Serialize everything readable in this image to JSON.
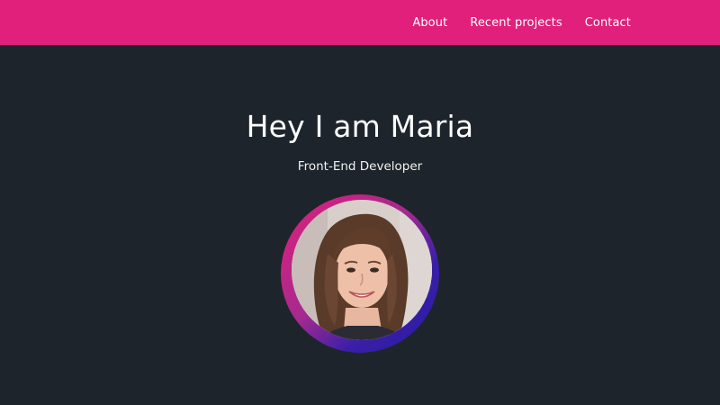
{
  "header": {
    "bg_color": "#e0207a",
    "nav": [
      {
        "label": "About"
      },
      {
        "label": "Recent projects"
      },
      {
        "label": "Contact"
      }
    ]
  },
  "hero": {
    "title": "Hey I am Maria",
    "subtitle": "Front-End Developer",
    "avatar_icon": "profile-photo"
  },
  "colors": {
    "background": "#1e242b",
    "accent_pink": "#e0207a",
    "accent_blue": "#2a1aa3"
  }
}
